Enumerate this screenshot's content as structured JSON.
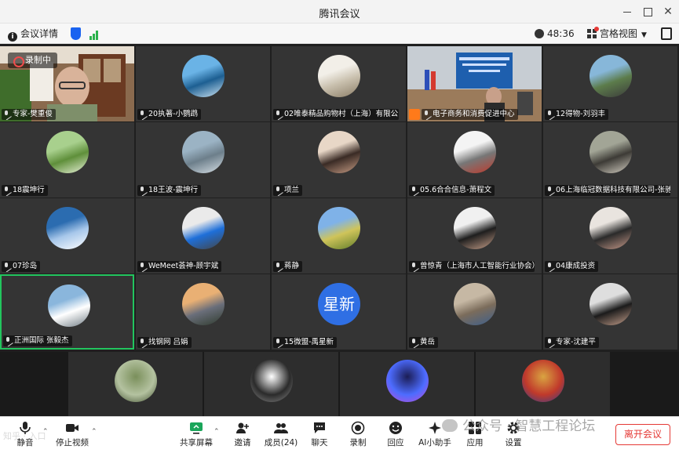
{
  "window": {
    "title": "腾讯会议"
  },
  "infobar": {
    "meeting_details": "会议详情",
    "timer": "48:36",
    "view_mode": "宫格视图"
  },
  "recording": {
    "label": "录制中"
  },
  "participants": [
    {
      "name": "专家-樊重俊",
      "kind": "video",
      "scene": "office",
      "active": false
    },
    {
      "name": "20执著-小鹦鹉",
      "kind": "avatar",
      "colors": [
        "#6ab3e6",
        "#1d5f92",
        "#cfe6f4"
      ]
    },
    {
      "name": "02唯泰精品购物村（上海）有限公...",
      "kind": "avatar",
      "colors": [
        "#f2efe8",
        "#c9c0ae",
        "#8a7d66"
      ]
    },
    {
      "name": "电子商务和消费促进中心",
      "kind": "video",
      "scene": "meeting",
      "share": true
    },
    {
      "name": "12得物-刘羽丰",
      "kind": "avatar",
      "colors": [
        "#87b7d9",
        "#5c7c4b",
        "#3b3b3b"
      ]
    },
    {
      "name": "18震坤行",
      "kind": "avatar",
      "colors": [
        "#a8d08d",
        "#5f8f3a",
        "#e8f1d8"
      ]
    },
    {
      "name": "18王波-震坤行",
      "kind": "avatar",
      "colors": [
        "#9bb3c4",
        "#6d7f8b",
        "#d7e0e6"
      ]
    },
    {
      "name": "项兰",
      "kind": "avatar",
      "colors": [
        "#e8d7c7",
        "#3a2b25",
        "#c99e86"
      ]
    },
    {
      "name": "05.6合合信息-萧程文",
      "kind": "avatar",
      "colors": [
        "#f4f4f4",
        "#777777",
        "#c0392b"
      ]
    },
    {
      "name": "06上海临冠数据科技有限公司-张驰",
      "kind": "avatar",
      "colors": [
        "#a2a596",
        "#3d3b36",
        "#d4cfc3"
      ]
    },
    {
      "name": "07珍岛",
      "kind": "avatar",
      "colors": [
        "#2b6cb0",
        "#a7c7ea",
        "#ffffff"
      ]
    },
    {
      "name": "WeMeet荟神-顾宇斌",
      "kind": "avatar",
      "colors": [
        "#eaeaea",
        "#1e6fd9",
        "#444444"
      ]
    },
    {
      "name": "蒋静",
      "kind": "avatar",
      "colors": [
        "#7fb2e8",
        "#cfc45a",
        "#5f7c2a"
      ]
    },
    {
      "name": "曾惊青（上海市人工智能行业协会）",
      "kind": "avatar",
      "colors": [
        "#f0f0f0",
        "#1e1e1e",
        "#c8a08a"
      ]
    },
    {
      "name": "04康成投资",
      "kind": "avatar",
      "colors": [
        "#e9e4df",
        "#2a2a2a",
        "#c79a8a"
      ]
    },
    {
      "name": "正洲国际 张毅杰",
      "kind": "avatar",
      "colors": [
        "#8ab6dc",
        "#ffffff",
        "#6f7b83"
      ],
      "active": true
    },
    {
      "name": "找钢网 吕娟",
      "kind": "avatar",
      "colors": [
        "#e9b074",
        "#6a6e7a",
        "#2f3b2e"
      ]
    },
    {
      "name": "15微盟-禹星新",
      "kind": "text",
      "text": "星新"
    },
    {
      "name": "黄岳",
      "kind": "avatar",
      "colors": [
        "#c6b8a4",
        "#7b6c5b",
        "#3d5f8c"
      ]
    },
    {
      "name": "专家-沈建平",
      "kind": "avatar",
      "colors": [
        "#dedede",
        "#1b1b1b",
        "#c7a18d"
      ]
    }
  ],
  "strip": [
    {
      "colors": [
        "#7a8f5b",
        "#b4c2a0",
        "#3e4c2e"
      ]
    },
    {
      "colors": [
        "#ffffff",
        "#2b2b2b",
        "#8a8a8a"
      ]
    },
    {
      "colors": [
        "#1b1d55",
        "#4d6cff",
        "#c44dd6"
      ]
    },
    {
      "colors": [
        "#d9a441",
        "#c0392b",
        "#2c3e8f"
      ]
    }
  ],
  "toolbar": {
    "mute": "静音",
    "stop_video": "停止视频",
    "share_screen": "共享屏幕",
    "invite": "邀请",
    "members": "成员(24)",
    "chat": "聊天",
    "record": "录制",
    "reactions": "回应",
    "ai_assistant": "AI小助手",
    "apps": "应用",
    "settings": "设置",
    "leave": "离开会议"
  },
  "watermark": {
    "text": "公众号 · 智慧工程论坛",
    "left_text": "知乎 · 入口"
  }
}
